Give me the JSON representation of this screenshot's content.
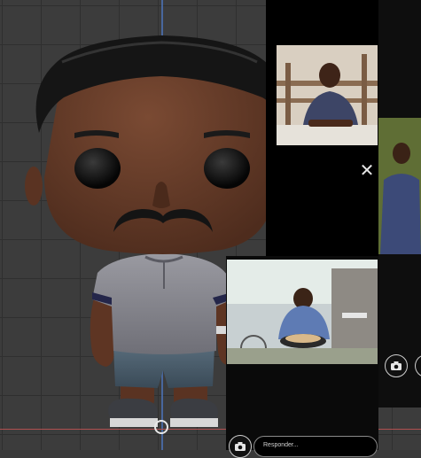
{
  "viewport": {
    "grid": true
  },
  "story_panel": {
    "reply_placeholder": "Responder..."
  },
  "icons": {
    "close": "close-icon",
    "camera": "camera-icon"
  },
  "colors": {
    "viewport_bg": "#3c3c3c",
    "grid_line": "#2f2f2f",
    "z_axis": "#4a6fae",
    "x_axis": "#b05050",
    "skin": "#6b3f2a",
    "hair": "#121212",
    "shirt": "#8b8b91",
    "shorts": "#4b5d6b",
    "panel_bg": "#000000"
  }
}
